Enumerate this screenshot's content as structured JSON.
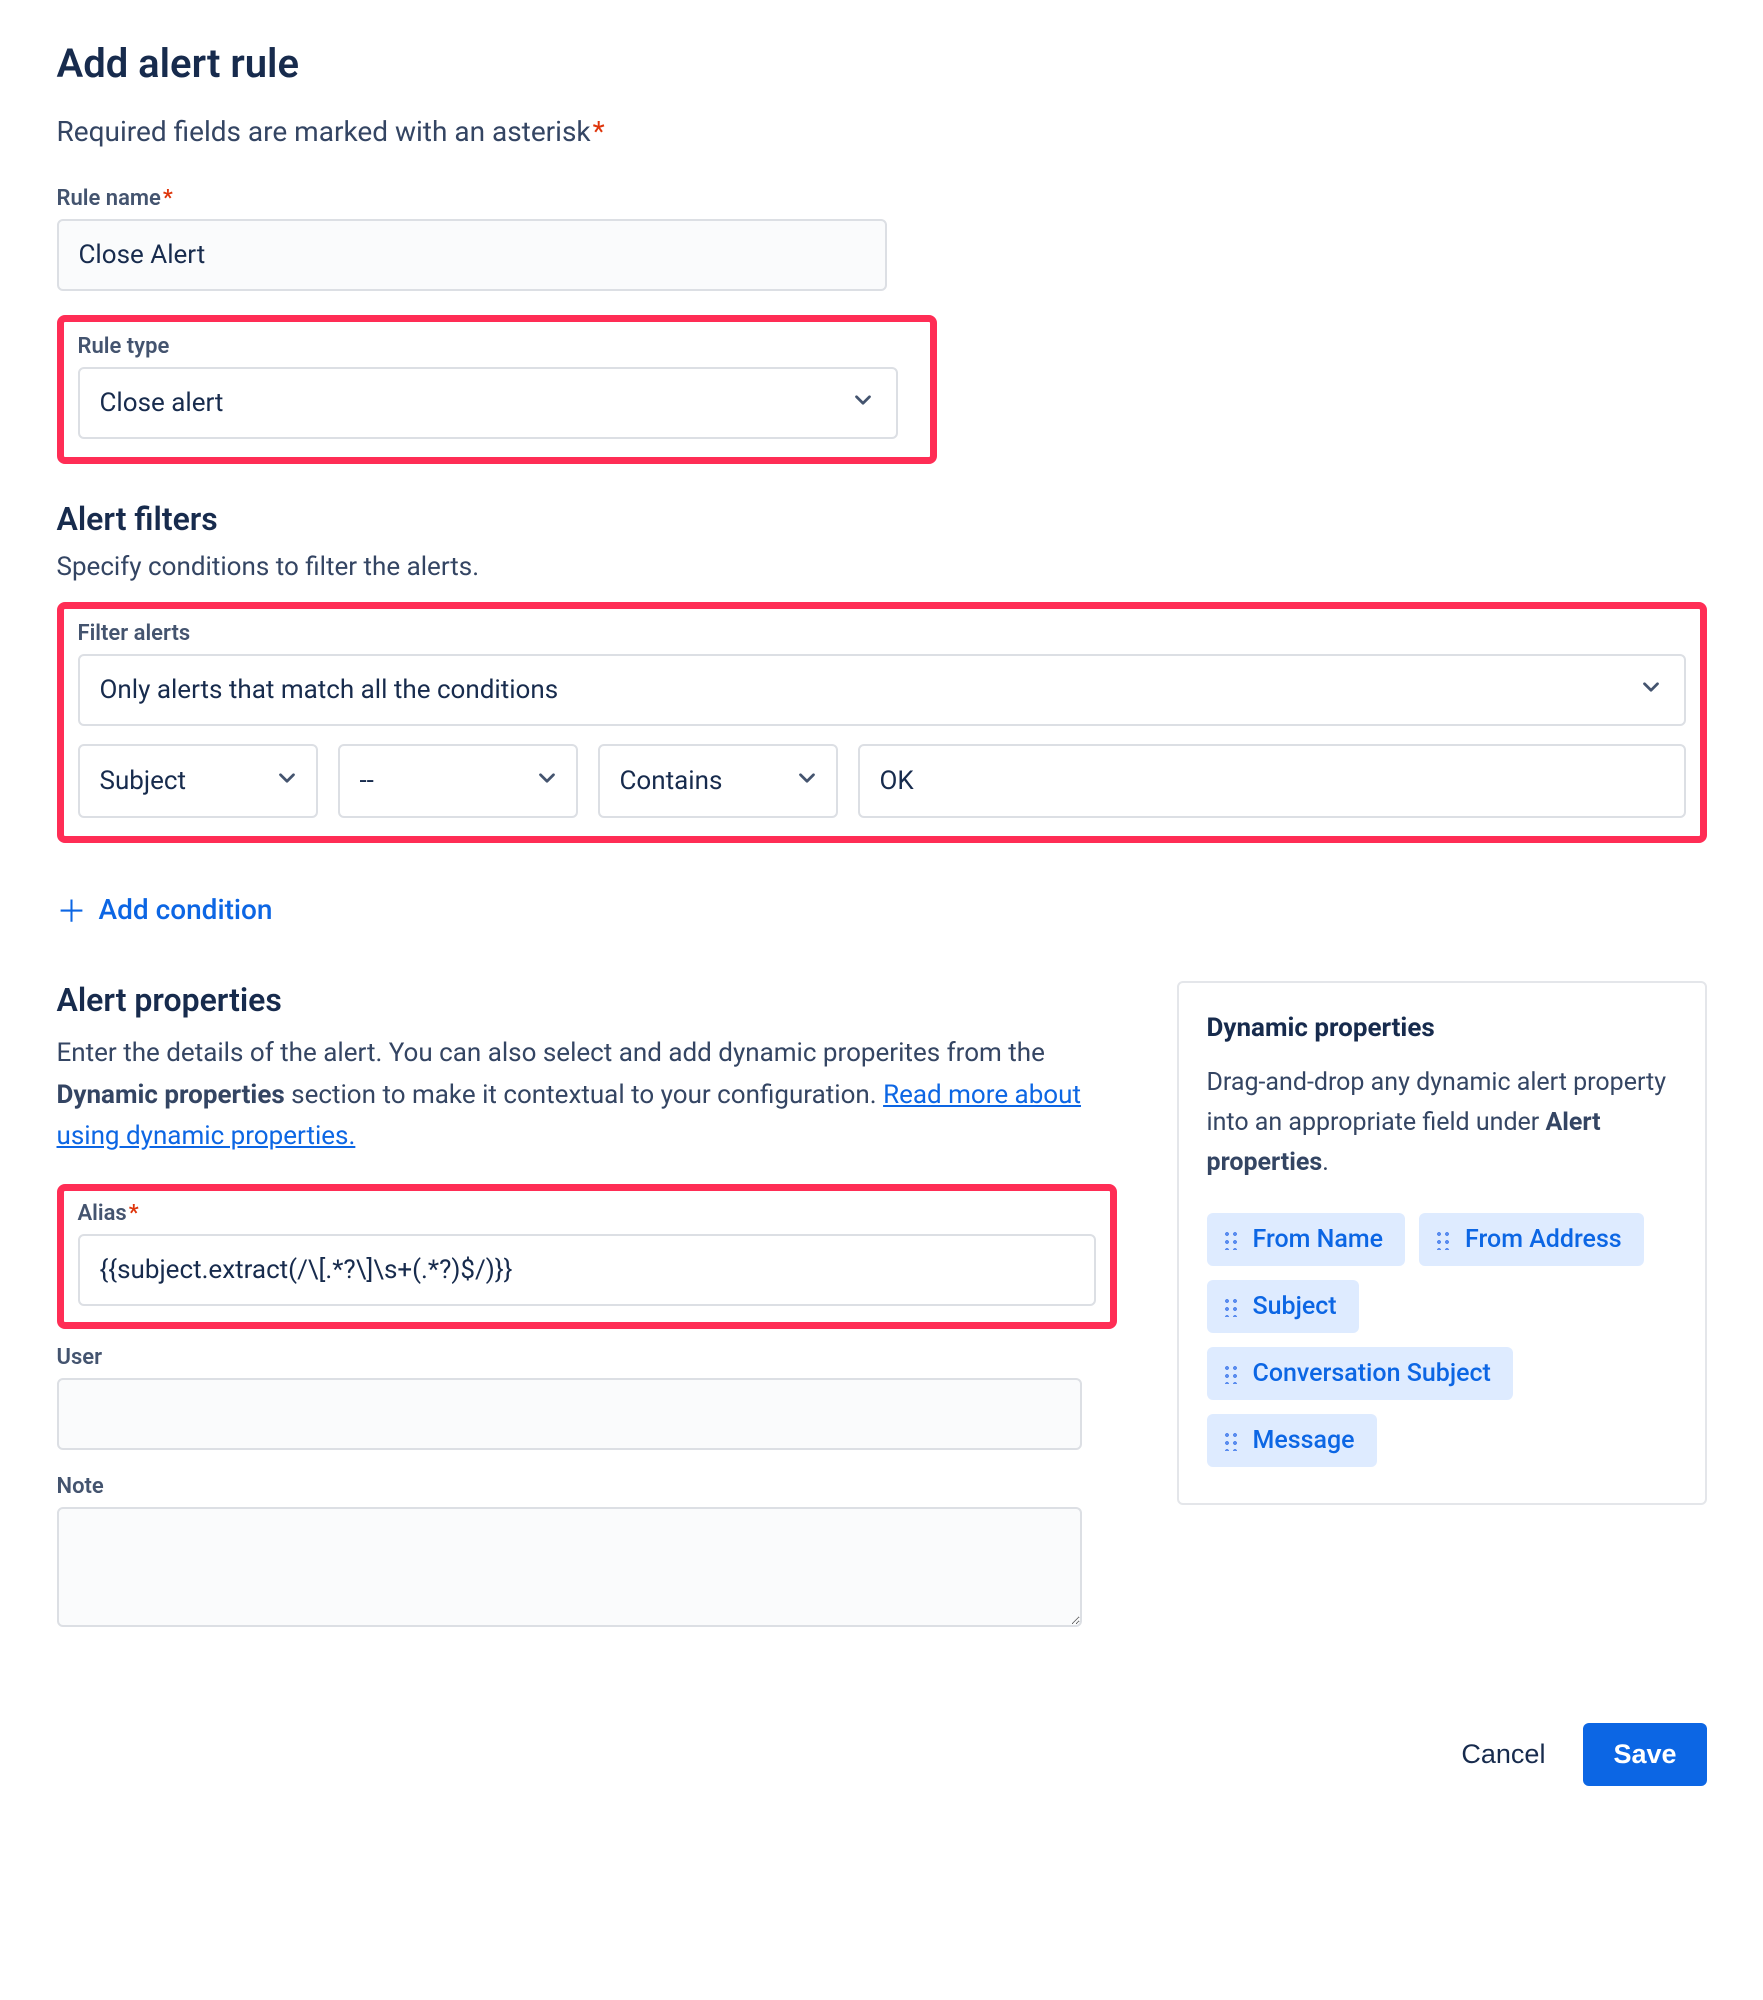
{
  "header": {
    "title": "Add alert rule",
    "required_note": "Required fields are marked with an asterisk",
    "asterisk": "*"
  },
  "rule_name": {
    "label": "Rule name",
    "value": "Close Alert"
  },
  "rule_type": {
    "label": "Rule type",
    "value": "Close alert"
  },
  "filters": {
    "heading": "Alert filters",
    "desc": "Specify conditions to filter the alerts.",
    "label": "Filter alerts",
    "mode": "Only alerts that match all the conditions",
    "condition": {
      "field": "Subject",
      "op1": "--",
      "op2": "Contains",
      "value": "OK"
    },
    "add_label": "Add condition"
  },
  "properties": {
    "heading": "Alert properties",
    "desc_pre": "Enter the details of the alert. You can also select and add dynamic properites from the ",
    "desc_bold": "Dynamic properties",
    "desc_mid": " section to make it contextual to your configuration. ",
    "desc_link": "Read more about using dynamic properties.",
    "alias_label": "Alias",
    "alias_value": "{{subject.extract(/\\[.*?\\]\\s+(.*?)$/)}}",
    "user_label": "User",
    "user_value": "",
    "note_label": "Note",
    "note_value": ""
  },
  "dynamic": {
    "heading": "Dynamic properties",
    "desc_pre": "Drag-and-drop any dynamic alert property into an appropriate field under ",
    "desc_bold": "Alert properties",
    "desc_post": ".",
    "chips": [
      "From Name",
      "From Address",
      "Subject",
      "Conversation Subject",
      "Message"
    ]
  },
  "footer": {
    "cancel": "Cancel",
    "save": "Save"
  }
}
